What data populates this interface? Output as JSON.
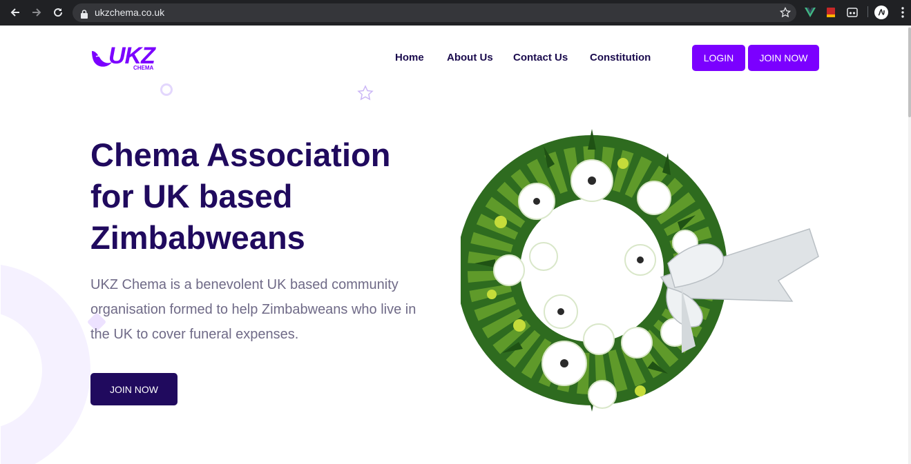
{
  "browser": {
    "url": "ukzchema.co.uk",
    "icons": [
      "back-icon",
      "forward-icon",
      "reload-icon",
      "lock-icon",
      "bookmark-star-icon",
      "vue-devtools-icon",
      "bookmark-extension-icon",
      "reader-extension-icon",
      "profile-avatar-icon",
      "menu-kebab-icon"
    ]
  },
  "header": {
    "logo_main": "UKZ",
    "logo_sub": "CHEMA",
    "nav": [
      {
        "label": "Home"
      },
      {
        "label": "About Us"
      },
      {
        "label": "Contact Us"
      },
      {
        "label": "Constitution"
      }
    ],
    "login_label": "LOGIN",
    "join_label": "JOIN NOW"
  },
  "hero": {
    "title_line1": "Chema Association",
    "title_line2": "for UK based",
    "title_line3": "Zimbabweans",
    "description": "UKZ Chema is a benevolent UK based community organisation formed to help Zimbabweans who live in the UK to cover funeral expenses.",
    "cta_label": "JOIN NOW",
    "image": "funeral-wreath-image"
  },
  "colors": {
    "brand_purple": "#7b00ff",
    "dark_navy": "#200a5e",
    "body_text": "#6f6a87",
    "chrome_bg": "#202124"
  }
}
